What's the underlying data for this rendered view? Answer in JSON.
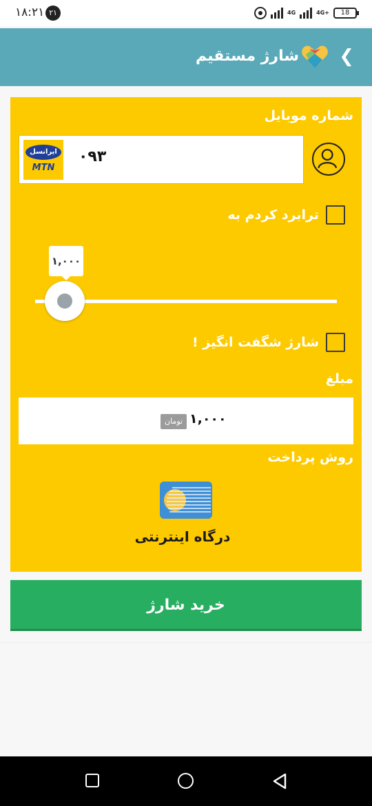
{
  "status_bar": {
    "time": "۱۸:۲۱",
    "notification_count": "۲۱",
    "network_1": "4G",
    "network_2": "4G+",
    "battery": "18"
  },
  "app_bar": {
    "title": "شارژ مستقیم",
    "back_icon": "chevron-left-icon",
    "logo_icon": "app-heart-logo-icon"
  },
  "form": {
    "mobile_label": "شماره موبایل",
    "phone_value": "۰۹۳",
    "operator": {
      "top_text": "ایرانسل",
      "bottom_text": "MTN"
    },
    "contact_icon": "contact-person-icon",
    "transfer_label": "ترابرد کردم به",
    "transfer_checked": false,
    "slider_value": "۱,۰۰۰",
    "wonder_label": "شارژ شگفت انگیز !",
    "wonder_checked": false,
    "amount_label": "مبلغ",
    "amount_value": "۱,۰۰۰",
    "amount_unit": "تومان",
    "payment_label": "روش پرداخت",
    "gateway_label": "درگاه اینترنتی",
    "gateway_icon": "bank-card-icon"
  },
  "buy_button": "خرید شارژ",
  "colors": {
    "app_bar": "#5aa9b9",
    "card": "#fdca00",
    "buy_button": "#27ae60"
  },
  "nav_bar": {
    "recent_icon": "square-recent-apps-icon",
    "home_icon": "circle-home-icon",
    "back_icon": "triangle-back-icon"
  }
}
